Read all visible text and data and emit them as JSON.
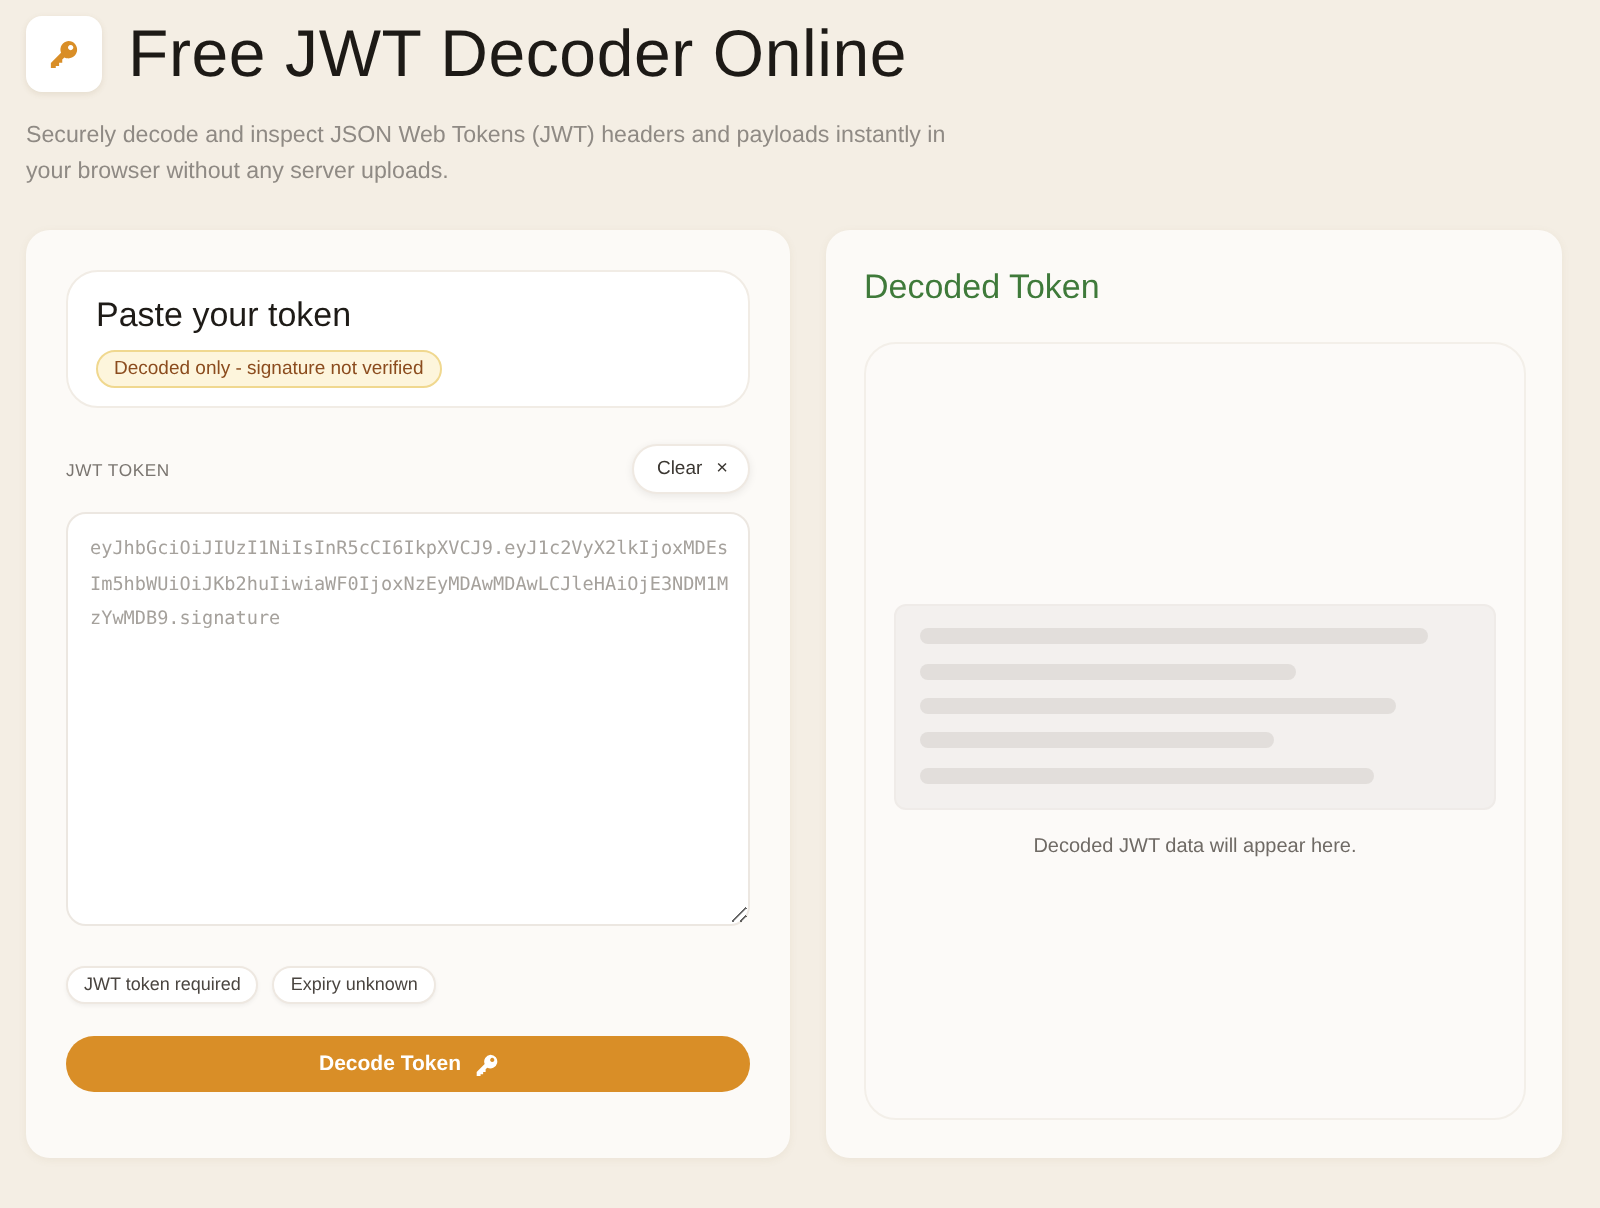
{
  "header": {
    "title": "Free JWT Decoder Online",
    "subtitle": "Securely decode and inspect JSON Web Tokens (JWT) headers and payloads instantly in your browser without any server uploads."
  },
  "input_panel": {
    "card_title": "Paste your token",
    "notice": "Decoded only - signature not verified",
    "field_label": "JWT TOKEN",
    "clear_button": {
      "label": "Clear",
      "icon": "×"
    },
    "token_field": {
      "placeholder": "eyJhbGciOiJIUzI1NiIsInR5cCI6IkpXVCJ9.eyJ1c2VyX2lkIjoxMDEsIm5hbWUiOiJKb2huIiwiaWF0IjoxNzEyMDAwMDAwLCJleHAiOjE3NDM1MzYwMDB9.signature"
    },
    "status_chips": [
      "JWT token required",
      "Expiry unknown"
    ],
    "decode_button": "Decode Token"
  },
  "output_panel": {
    "title": "Decoded Token",
    "empty_message": "Decoded JWT data will appear here."
  }
}
